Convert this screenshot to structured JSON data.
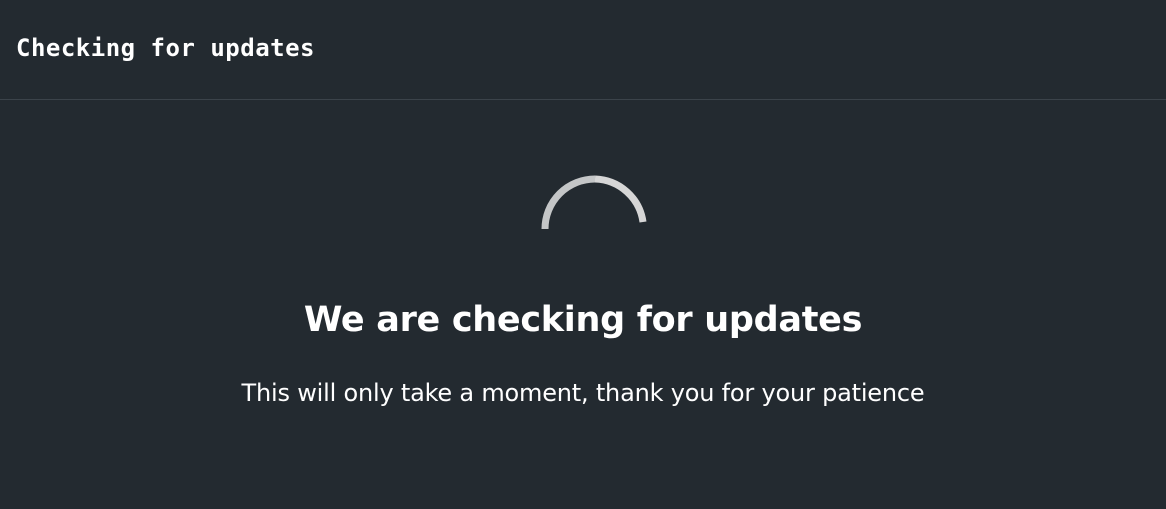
{
  "window": {
    "title": "Checking for updates"
  },
  "main": {
    "spinner_icon": "loading-spinner-icon",
    "heading": "We are checking for updates",
    "message": "This will only take a moment, thank you for your patience"
  },
  "colors": {
    "background": "#232a30",
    "divider": "#3b434a",
    "text": "#ffffff",
    "spinner": "#c8c8c8"
  }
}
